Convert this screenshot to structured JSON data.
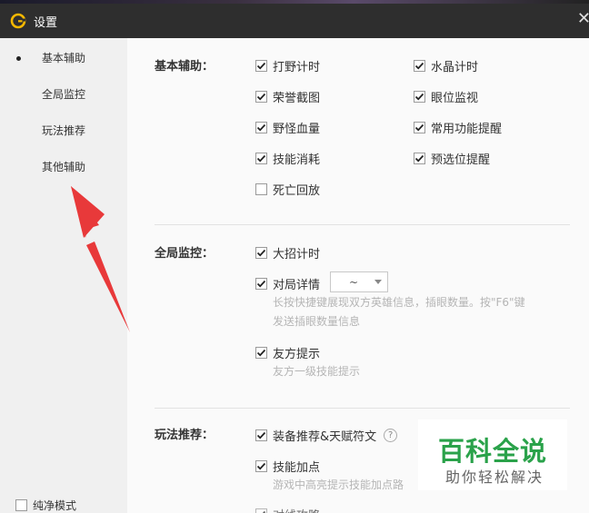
{
  "window": {
    "title": "设置",
    "close_glyph": "✕"
  },
  "sidebar": {
    "items": [
      {
        "label": "基本辅助",
        "active": true
      },
      {
        "label": "全局监控"
      },
      {
        "label": "玩法推荐"
      },
      {
        "label": "其他辅助"
      }
    ],
    "pure_mode": {
      "label": "纯净模式",
      "checked": false
    }
  },
  "sections": {
    "basic": {
      "label": "基本辅助：",
      "options": [
        {
          "label": "打野计时",
          "checked": true
        },
        {
          "label": "水晶计时",
          "checked": true
        },
        {
          "label": "荣誉截图",
          "checked": true
        },
        {
          "label": "眼位监视",
          "checked": true
        },
        {
          "label": "野怪血量",
          "checked": true
        },
        {
          "label": "常用功能提醒",
          "checked": true
        },
        {
          "label": "技能消耗",
          "checked": true
        },
        {
          "label": "预选位提醒",
          "checked": true
        },
        {
          "label": "死亡回放",
          "checked": false
        }
      ]
    },
    "global": {
      "label": "全局监控：",
      "ult_timer": {
        "label": "大招计时",
        "checked": true
      },
      "match_detail": {
        "label": "对局详情",
        "checked": true,
        "select_value": "~"
      },
      "match_detail_hint_1": "长按快捷键展现双方英雄信息，插眼数量。按\"F6\"键",
      "match_detail_hint_2": "发送插眼数量信息",
      "ally_tip": {
        "label": "友方提示",
        "checked": true
      },
      "ally_tip_hint": "友方一级技能提示"
    },
    "play": {
      "label": "玩法推荐：",
      "equip": {
        "label": "装备推荐&天赋符文",
        "checked": true
      },
      "skill": {
        "label": "技能加点",
        "checked": true
      },
      "skill_hint": "游戏中高亮提示技能加点路",
      "partial_label": "对线攻略",
      "help_glyph": "?"
    }
  },
  "watermark": {
    "title": "百科全说",
    "subtitle": "助你轻松解决"
  },
  "colors": {
    "titlebar": "#2e2e2e",
    "sidebar": "#f0f0f0",
    "content": "#fafafa",
    "arrow": "#e8393a",
    "watermark_green": "#2aa24a",
    "logo": "#f5b800"
  }
}
